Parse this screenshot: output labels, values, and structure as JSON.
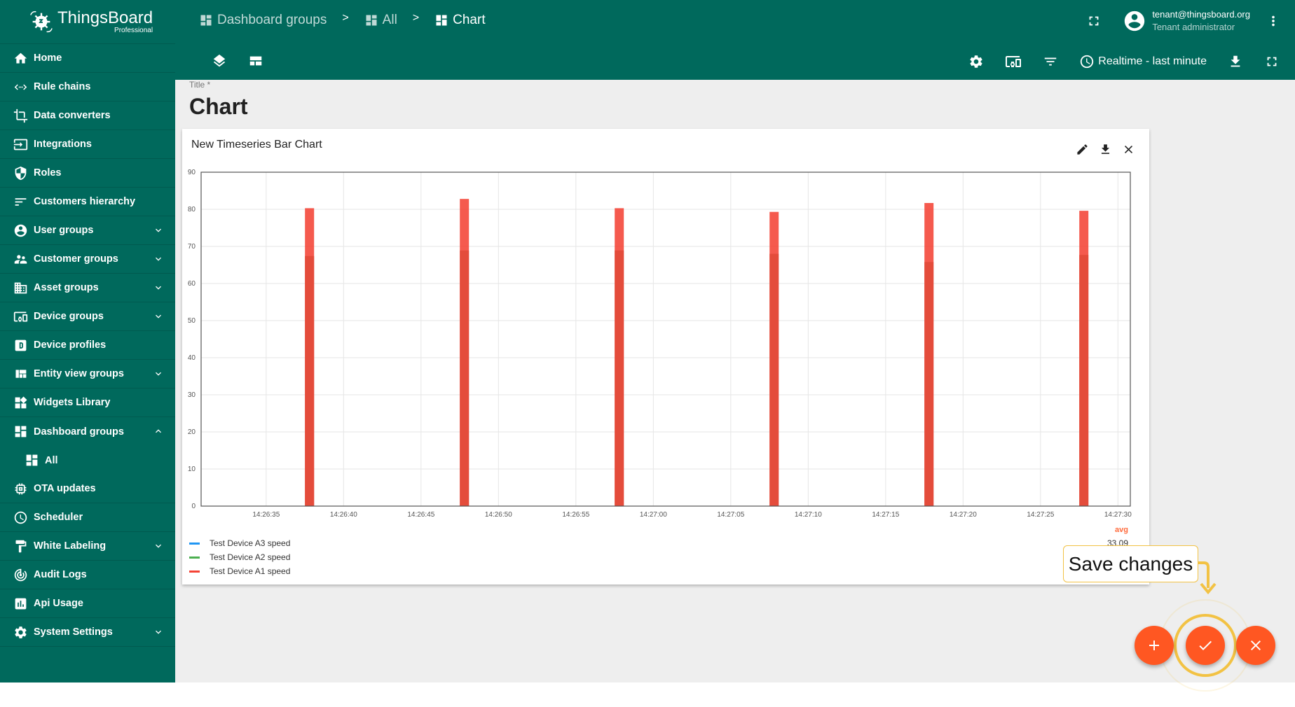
{
  "app": {
    "name": "ThingsBoard",
    "edition": "Professional"
  },
  "sidebar": {
    "items": [
      {
        "label": "Home",
        "icon": "home-icon"
      },
      {
        "label": "Rule chains",
        "icon": "rule-chain-icon"
      },
      {
        "label": "Data converters",
        "icon": "crop-icon"
      },
      {
        "label": "Integrations",
        "icon": "input-icon"
      },
      {
        "label": "Roles",
        "icon": "shield-icon"
      },
      {
        "label": "Customers hierarchy",
        "icon": "sort-icon"
      },
      {
        "label": "User groups",
        "icon": "account-circle-icon",
        "expandable": true
      },
      {
        "label": "Customer groups",
        "icon": "supervisor-icon",
        "expandable": true
      },
      {
        "label": "Asset groups",
        "icon": "domain-icon",
        "expandable": true
      },
      {
        "label": "Device groups",
        "icon": "devices-icon",
        "expandable": true
      },
      {
        "label": "Device profiles",
        "icon": "device-profile-icon"
      },
      {
        "label": "Entity view groups",
        "icon": "view-quilt-icon",
        "expandable": true
      },
      {
        "label": "Widgets Library",
        "icon": "widgets-icon"
      },
      {
        "label": "Dashboard groups",
        "icon": "dashboard-icon",
        "expandable": true,
        "expanded": true
      },
      {
        "label": "All",
        "icon": "dashboard-icon",
        "sub": true
      },
      {
        "label": "OTA updates",
        "icon": "memory-icon"
      },
      {
        "label": "Scheduler",
        "icon": "clock-icon"
      },
      {
        "label": "White Labeling",
        "icon": "format-paint-icon",
        "expandable": true
      },
      {
        "label": "Audit Logs",
        "icon": "track-changes-icon"
      },
      {
        "label": "Api Usage",
        "icon": "insert-chart-icon"
      },
      {
        "label": "System Settings",
        "icon": "settings-icon",
        "expandable": true
      }
    ]
  },
  "header": {
    "breadcrumb": [
      "Dashboard groups",
      "All",
      "Chart"
    ],
    "separator": ">",
    "user": {
      "email": "tenant@thingsboard.org",
      "role": "Tenant administrator"
    },
    "timewindow": "Realtime - last minute"
  },
  "main": {
    "title_label": "Title *",
    "title_value": "Chart"
  },
  "widget": {
    "title": "New Timeseries Bar Chart",
    "avg_label": "avg",
    "avg_value": "33.09"
  },
  "tooltip": {
    "text": "Save changes"
  },
  "colors": {
    "primary": "#00695c",
    "accent": "#ff5722",
    "highlight": "#f2c244"
  },
  "chart_data": {
    "type": "bar",
    "title": "New Timeseries Bar Chart",
    "xlabel": "",
    "ylabel": "",
    "ylim": [
      0,
      90
    ],
    "yticks": [
      0,
      10,
      20,
      30,
      40,
      50,
      60,
      70,
      80,
      90
    ],
    "xlim_seconds": [
      30.8,
      90.8
    ],
    "xtick_seconds": [
      35,
      40,
      45,
      50,
      55,
      60,
      65,
      70,
      75,
      80,
      85,
      90
    ],
    "xticks": [
      "14:26:35",
      "14:26:40",
      "14:26:45",
      "14:26:50",
      "14:26:55",
      "14:27:00",
      "14:27:05",
      "14:27:10",
      "14:27:15",
      "14:27:20",
      "14:27:25",
      "14:27:30"
    ],
    "grid": true,
    "legend": "bottom-left",
    "x_seconds": [
      37.8,
      47.8,
      57.8,
      67.8,
      77.8,
      87.8
    ],
    "series": [
      {
        "name": "Test Device A3 speed",
        "color": "#2196f3",
        "values": []
      },
      {
        "name": "Test Device A2 speed",
        "color": "#4caf50",
        "values": [
          67.4,
          68.9,
          68.9,
          68.0,
          65.8,
          67.7
        ]
      },
      {
        "name": "Test Device A1 speed",
        "color": "#f44336",
        "values": [
          80.3,
          82.8,
          80.3,
          79.3,
          81.7,
          79.6
        ]
      }
    ]
  }
}
